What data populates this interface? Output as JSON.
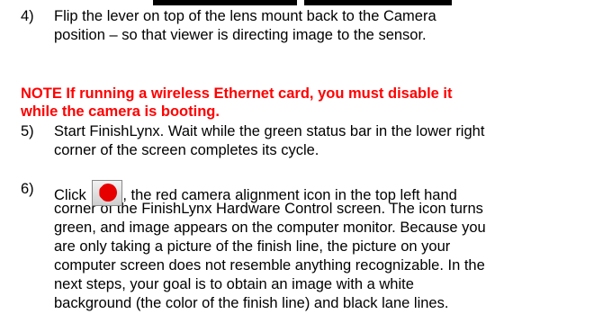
{
  "steps": [
    {
      "number": "4)",
      "lines": [
        "Flip the lever on top of the lens mount back to the Camera",
        "position – so that viewer is directing image to the sensor."
      ]
    },
    {
      "number": "5)",
      "lines": [
        "Start FinishLynx. Wait while the green status bar in the lower right",
        "corner of the screen completes its cycle."
      ]
    },
    {
      "number": "6)",
      "lead": "Click",
      "after_icon": ", the red camera alignment icon in the top left hand",
      "lines": [
        "corner of the FinishLynx Hardware Control screen. The icon turns",
        "green, and image appears on the computer monitor. Because you",
        "are only taking a picture of the finish line, the picture on your",
        "computer screen does not resemble anything recognizable. In the",
        "next steps, your goal is to obtain an image with a white",
        "background (the color of the finish line) and black lane lines."
      ],
      "icon": "red-camera-alignment-icon"
    }
  ],
  "note": {
    "lines": [
      "NOTE If running a wireless Ethernet card, you must disable it",
      "while the camera is booting."
    ],
    "color": "#ff0000"
  }
}
